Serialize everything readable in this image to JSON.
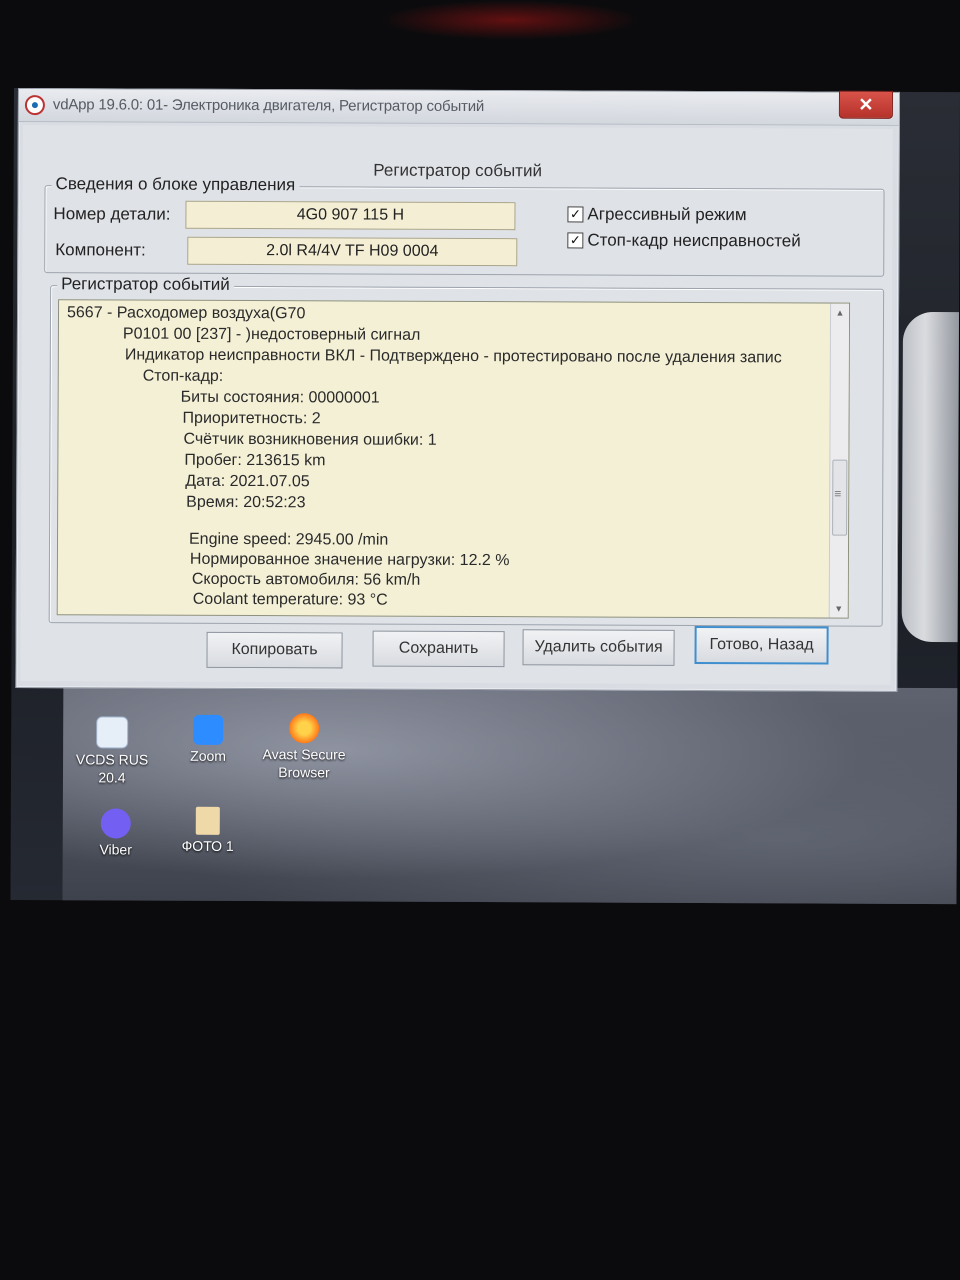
{
  "window": {
    "title": "vdApp 19.6.0: 01- Электроника двигателя,  Регистратор событий",
    "close_glyph": "✕"
  },
  "dialog": {
    "heading": "Регистратор событий",
    "ecu_group": {
      "legend": "Сведения о блоке управления",
      "part_number_label": "Номер детали:",
      "part_number_value": "4G0 907 115 H",
      "component_label": "Компонент:",
      "component_value": "2.0l R4/4V TF H09 0004",
      "aggressive_mode_label": "Агрессивный режим",
      "aggressive_mode_checked": true,
      "freeze_frame_label": "Стоп-кадр неисправностей",
      "freeze_frame_checked": true
    },
    "log_group": {
      "legend": "Регистратор событий",
      "lines": [
        "5667 - Расходомер воздуха(G70",
        "P0101 00 [237] - )недостоверный сигнал",
        "Индикатор неисправности ВКЛ - Подтверждено - протестировано после удаления запис",
        "Стоп-кадр:",
        "Биты состояния: 00000001",
        "Приоритетность: 2",
        "Счётчик возникновения ошибки: 1",
        "Пробег: 213615 km",
        "Дата: 2021.07.05",
        "Время: 20:52:23",
        "Engine speed: 2945.00 /min",
        "Нормированное значение нагрузки: 12.2 %",
        "Скорость автомобиля: 56 km/h",
        "Coolant temperature: 93 °C"
      ]
    },
    "buttons": {
      "copy": "Копировать",
      "save": "Сохранить",
      "delete": "Удалить события",
      "done": "Готово, Назад"
    }
  },
  "desktop_icons": [
    {
      "label_1": "VCDS RUS",
      "label_2": "20.4",
      "icon": "vcds-icon",
      "color": "#e6eef8"
    },
    {
      "label_1": "Zoom",
      "label_2": "",
      "icon": "zoom-icon",
      "color": "#2d8cff"
    },
    {
      "label_1": "Avast Secure",
      "label_2": "Browser",
      "icon": "avast-browser-icon",
      "color": "#ff7a1a"
    },
    {
      "label_1": "Viber",
      "label_2": "",
      "icon": "viber-icon",
      "color": "#7360f2"
    },
    {
      "label_1": "ФОТО 1",
      "label_2": "",
      "icon": "folder-icon",
      "color": "#f0d9a8"
    }
  ]
}
